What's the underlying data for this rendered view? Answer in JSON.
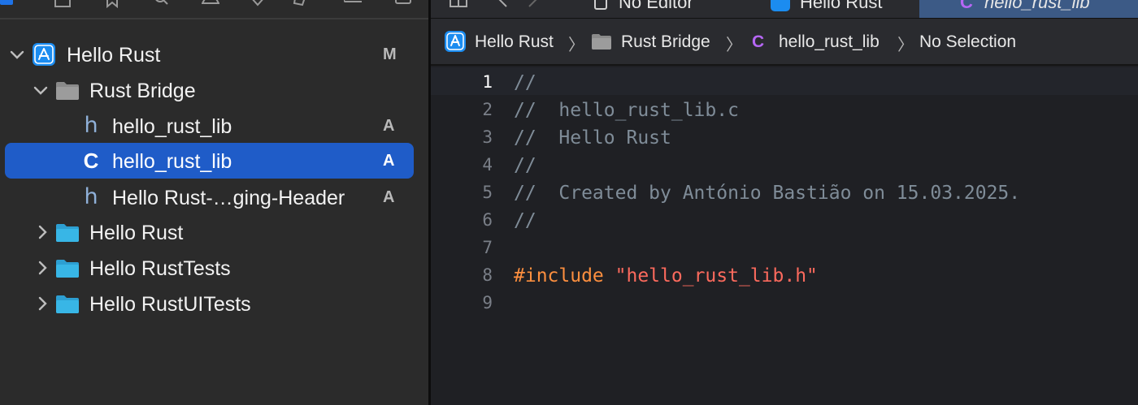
{
  "tabs": [
    {
      "label": "No Editor"
    },
    {
      "label": "Hello Rust"
    },
    {
      "label": "hello_rust_lib"
    }
  ],
  "jumpbar": {
    "items": [
      {
        "label": "Hello Rust",
        "icon": "app-project-icon"
      },
      {
        "label": "Rust Bridge",
        "icon": "folder-icon"
      },
      {
        "label": "hello_rust_lib",
        "icon": "c-file-icon",
        "icon_letter": "C"
      },
      {
        "label": "No Selection"
      }
    ],
    "separator": "〉"
  },
  "navigator": {
    "rows": [
      {
        "label": "Hello Rust",
        "badge": "M",
        "icon": "app-project-icon",
        "expanded": true
      },
      {
        "label": "Rust Bridge",
        "badge": "",
        "icon": "folder-icon",
        "expanded": true
      },
      {
        "label": "hello_rust_lib",
        "badge": "A",
        "icon": "h-file-icon",
        "icon_letter": "h"
      },
      {
        "label": "hello_rust_lib",
        "badge": "A",
        "icon": "c-file-icon",
        "icon_letter": "C",
        "selected": true
      },
      {
        "label": "Hello Rust-…ging-Header",
        "badge": "A",
        "icon": "h-file-icon",
        "icon_letter": "h"
      },
      {
        "label": "Hello Rust",
        "badge": "",
        "icon": "folder-icon",
        "expanded": false
      },
      {
        "label": "Hello RustTests",
        "badge": "",
        "icon": "folder-icon",
        "expanded": false
      },
      {
        "label": "Hello RustUITests",
        "badge": "",
        "icon": "folder-icon",
        "expanded": false
      }
    ]
  },
  "editor": {
    "current_line": 1,
    "lines": [
      {
        "number": "1",
        "comment": "//"
      },
      {
        "number": "2",
        "comment": "//  hello_rust_lib.c"
      },
      {
        "number": "3",
        "comment": "//  Hello Rust"
      },
      {
        "number": "4",
        "comment": "//"
      },
      {
        "number": "5",
        "comment": "//  Created by António Bastião on 15.03.2025."
      },
      {
        "number": "6",
        "comment": "//"
      },
      {
        "number": "7",
        "comment": ""
      },
      {
        "number": "8",
        "keyword": "#include",
        "string": "\"hello_rust_lib.h\""
      },
      {
        "number": "9",
        "comment": ""
      }
    ]
  },
  "colors": {
    "accent": "#1f5cc8",
    "folder_blue": "#38b6e6",
    "folder_gray": "#8a8a8a",
    "comment": "#7f8c98",
    "keyword": "#fd8f3f",
    "string": "#fc6a5d",
    "c_file_purple": "#b667f5"
  }
}
